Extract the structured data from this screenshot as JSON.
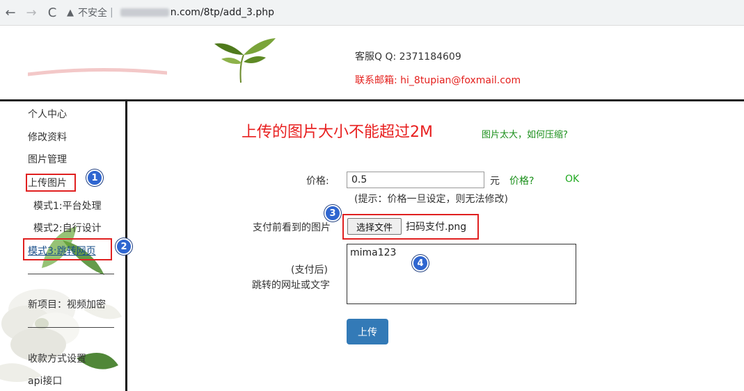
{
  "browser": {
    "back": "←",
    "forward": "→",
    "reload": "C",
    "security_label": "不安全",
    "separator": "|",
    "url_visible": "n.com/8tp/add_3.php"
  },
  "header": {
    "qq_label": "客服Q Q:",
    "qq_value": "2371184609",
    "email_label": "联系邮箱:",
    "email_value": "hi_8tupian@foxmail.com"
  },
  "sidebar": {
    "items": [
      {
        "label": "个人中心"
      },
      {
        "label": "修改资料"
      },
      {
        "label": "图片管理"
      },
      {
        "label": "上传图片"
      },
      {
        "label": "模式1:平台处理"
      },
      {
        "label": "模式2:自行设计"
      },
      {
        "label": "模式3:跳转网页"
      },
      {
        "label": "新项目：视频加密"
      },
      {
        "label": "收款方式设置"
      },
      {
        "label": "api接口"
      }
    ]
  },
  "main": {
    "title": "上传的图片大小不能超过2M",
    "compress_link": "图片太大，如何压缩?",
    "price_label": "价格:",
    "price_value": "0.5",
    "price_unit": "元",
    "price_help": "价格?",
    "price_ok": "OK",
    "price_hint": "(提示：价格一旦设定，则无法修改)",
    "image_label": "支付前看到的图片",
    "file_button": "选择文件",
    "file_name": "扫码支付.png",
    "after_label_1": "(支付后)",
    "after_label_2": "跳转的网址或文字",
    "after_value": "mima123",
    "upload_button": "上传"
  },
  "badges": [
    "1",
    "2",
    "3",
    "4"
  ],
  "colors": {
    "accent_red": "#e81f1f",
    "link_green": "#1a8f1a",
    "button_blue": "#337ab7",
    "badge_blue": "#2f66d0"
  }
}
